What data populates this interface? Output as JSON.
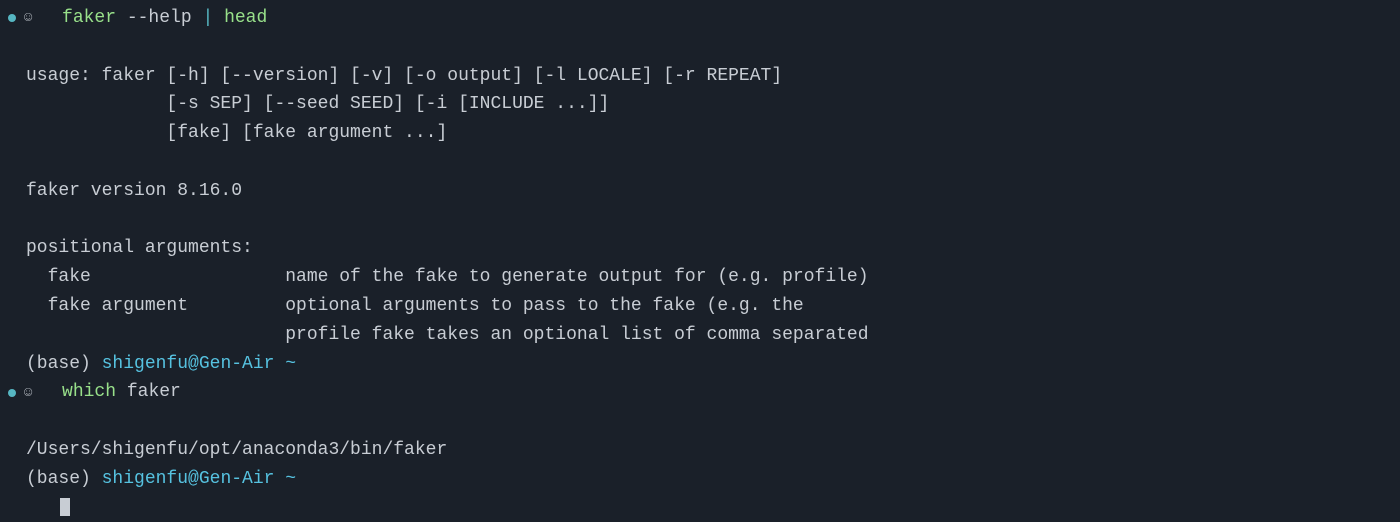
{
  "blocks": [
    {
      "type": "prompt",
      "cmd": "faker",
      "args_pre": " --help ",
      "pipe": "|",
      "args_post": " ",
      "cmd2": "head"
    },
    {
      "type": "blank"
    },
    {
      "type": "out",
      "text": "usage: faker [-h] [--version] [-v] [-o output] [-l LOCALE] [-r REPEAT]"
    },
    {
      "type": "out",
      "text": "             [-s SEP] [--seed SEED] [-i [INCLUDE ...]]"
    },
    {
      "type": "out",
      "text": "             [fake] [fake argument ...]"
    },
    {
      "type": "blank"
    },
    {
      "type": "out",
      "text": "faker version 8.16.0"
    },
    {
      "type": "blank"
    },
    {
      "type": "out",
      "text": "positional arguments:"
    },
    {
      "type": "out",
      "text": "  fake                  name of the fake to generate output for (e.g. profile)"
    },
    {
      "type": "out",
      "text": "  fake argument         optional arguments to pass to the fake (e.g. the"
    },
    {
      "type": "out",
      "text": "                        profile fake takes an optional list of comma separated"
    },
    {
      "type": "ps1",
      "env": "(base) ",
      "userhost": "shigenfu@Gen-Air",
      "path": " ~"
    },
    {
      "type": "prompt",
      "cmd": "which",
      "args_pre": " ",
      "pipe": "",
      "args_post": "faker",
      "cmd2": ""
    },
    {
      "type": "blank"
    },
    {
      "type": "out",
      "text": "/Users/shigenfu/opt/anaconda3/bin/faker"
    },
    {
      "type": "ps1",
      "env": "(base) ",
      "userhost": "shigenfu@Gen-Air",
      "path": " ~"
    },
    {
      "type": "cursor"
    }
  ]
}
